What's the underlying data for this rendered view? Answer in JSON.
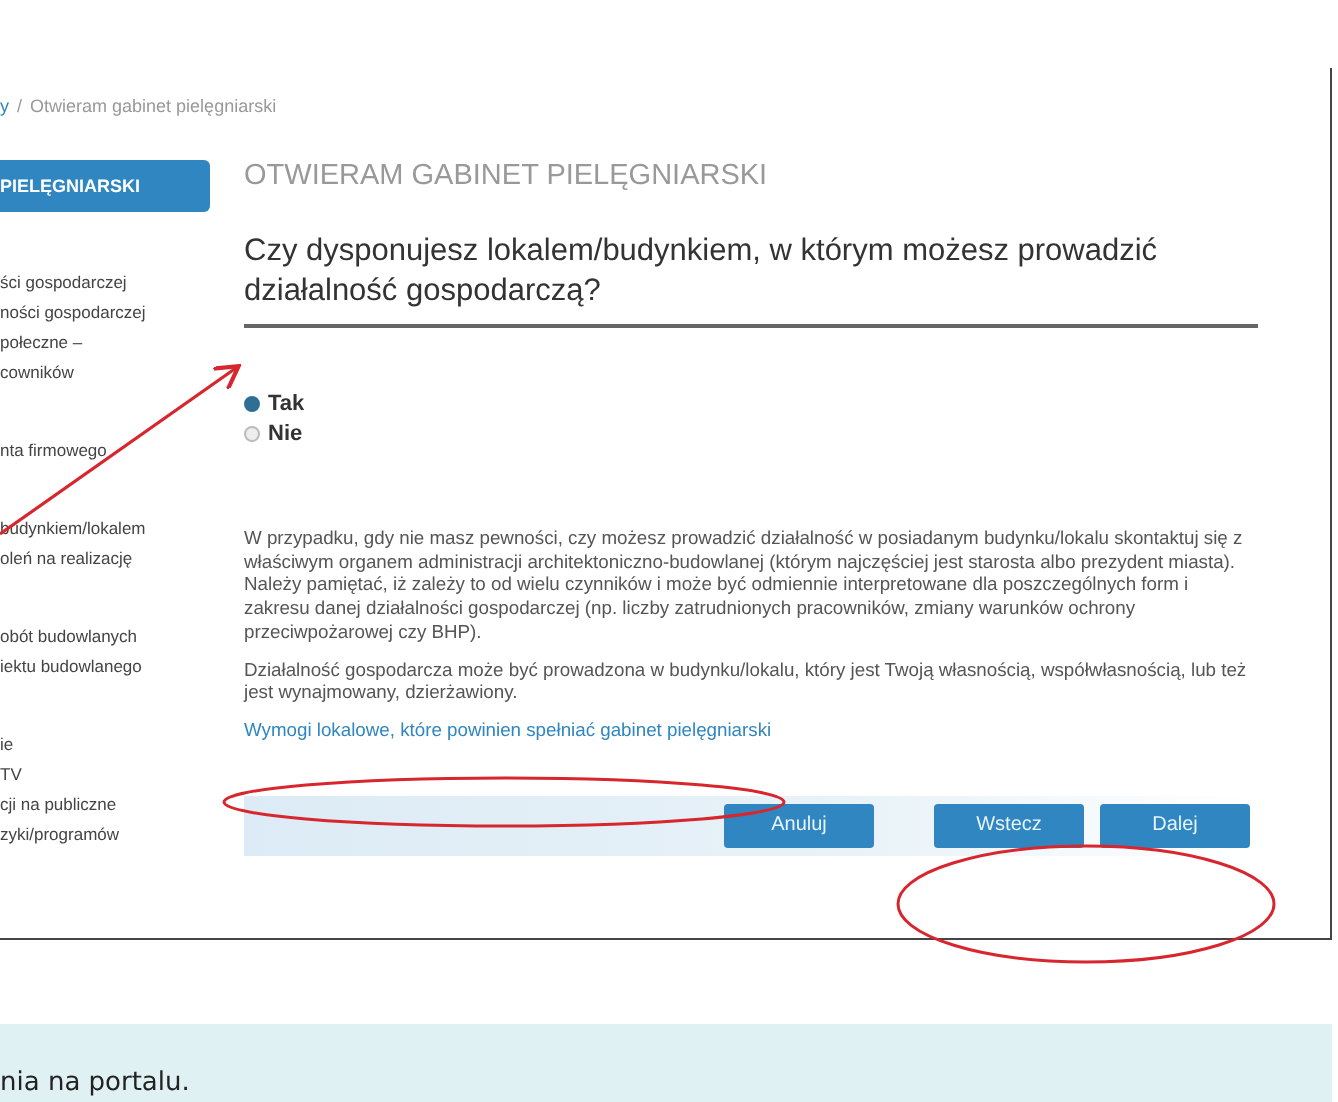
{
  "breadcrumb": {
    "link": "y",
    "separator": "/",
    "current": "Otwieram gabinet pielęgniarski"
  },
  "sidebar": {
    "active_item": "PIELĘGNIARSKI",
    "groups": [
      [
        "ści gospodarczej",
        "ności gospodarczej",
        "połeczne –",
        "cowników"
      ],
      [
        "nta firmowego"
      ],
      [
        "budynkiem/lokalem",
        "oleń na realizację"
      ],
      [
        "obót budowlanych",
        "iektu budowlanego"
      ],
      [
        "ie",
        "TV",
        "cji na publiczne",
        "zyki/programów"
      ]
    ]
  },
  "page_title": "OTWIERAM GABINET PIELĘGNIARSKI",
  "question": "Czy dysponujesz lokalem/budynkiem, w którym możesz prowadzić działalność gospodarczą?",
  "options": [
    {
      "label": "Tak",
      "selected": true
    },
    {
      "label": "Nie",
      "selected": false
    }
  ],
  "info_paragraphs": [
    "W przypadku, gdy nie masz pewności, czy możesz prowadzić działalność w posiadanym budynku/lokalu skontaktuj się z właściwym organem administracji architektoniczno-budowlanej (którym najczęściej jest starosta albo prezydent miasta). Należy pamiętać, iż zależy to od wielu czynników i może być odmiennie interpretowane dla poszczególnych form i zakresu danej działalności gospodarczej (np. liczby zatrudnionych pracowników, zmiany warunków ochrony przeciwpożarowej czy BHP).",
    "Działalność gospodarcza może być prowadzona w budynku/lokalu, który jest Twoją własnością, współwłasnością, lub też jest wynajmowany, dzierżawiony."
  ],
  "link": "Wymogi lokalowe, które powinien spełniać gabinet pielęgniarski",
  "buttons": [
    "Anuluj",
    "Wstecz",
    "Dalej"
  ],
  "caption": "nia na portalu."
}
